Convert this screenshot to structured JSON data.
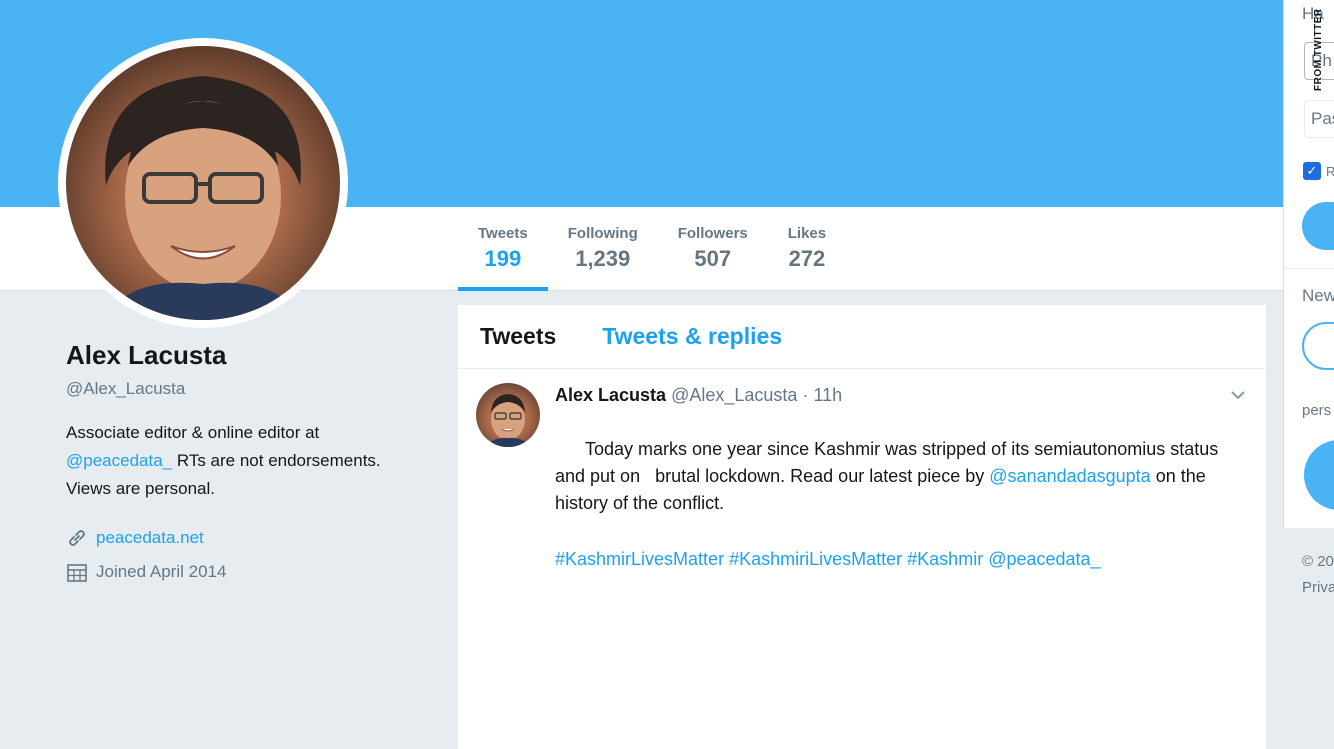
{
  "profile": {
    "name": "Alex Lacusta",
    "handle": "@Alex_Lacusta",
    "bio_mention": "@peacedata_",
    "bio_line1": "Associate editor & online editor at",
    "bio_after_mention": " RTs are not endorsements.",
    "bio_line3": "Views are personal.",
    "website": "peacedata.net",
    "joined": "Joined April 2014"
  },
  "stats": [
    {
      "label": "Tweets",
      "value": "199"
    },
    {
      "label": "Following",
      "value": "1,239"
    },
    {
      "label": "Followers",
      "value": "507"
    },
    {
      "label": "Likes",
      "value": "272"
    }
  ],
  "timeline": {
    "tabs": [
      "Tweets",
      "Tweets & replies"
    ],
    "tweet": {
      "author": "Alex Lacusta",
      "handle": "@Alex_Lacusta",
      "dot": "·",
      "time": "11h",
      "text_part1": "Today marks one year since Kashmir was stripped of its semiautonomius status and put on   brutal lockdown. Read our latest piece by ",
      "mention1": "@sanandadasgupta",
      "text_part2": " on the history of the conflict.",
      "hashtags": [
        "#KashmirLivesMatter",
        "#KashmiriLivesMatter",
        "#Kashmir",
        "@peacedata_"
      ]
    }
  },
  "right_panel": {
    "heading": "Ha",
    "input1": "Ph",
    "input2": "Pas",
    "check_label": "R",
    "new_text": "New",
    "pers_text": "pers"
  },
  "footer": {
    "line1": "© 20",
    "line2": "Priva"
  },
  "credit": "FROM TWITTER",
  "colors": {
    "banner": "#4ab3f4",
    "accent": "#1da1f2",
    "page_bg": "#e6ecf0"
  }
}
